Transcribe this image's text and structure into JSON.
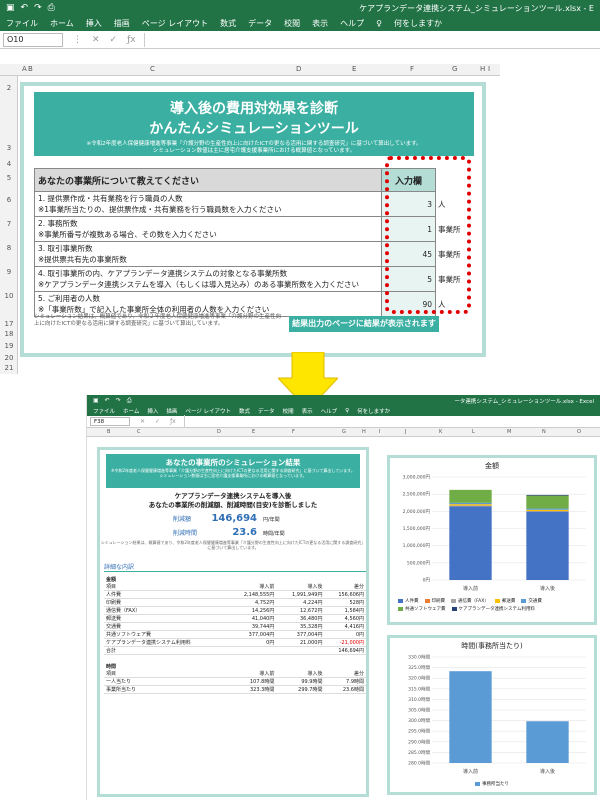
{
  "window": {
    "title": "ケアプランデータ連携システム_シミュレーションツール.xlsx  -  E"
  },
  "menu": [
    "ファイル",
    "ホーム",
    "挿入",
    "描画",
    "ページ レイアウト",
    "数式",
    "データ",
    "校閲",
    "表示",
    "ヘルプ"
  ],
  "search_hint": "何をしますか",
  "namebox": "O10",
  "columns": [
    "A",
    "B",
    "C",
    "D",
    "E",
    "F",
    "G",
    "H",
    "I"
  ],
  "rows": [
    "2",
    "3",
    "4",
    "5",
    "6",
    "7",
    "8",
    "9",
    "10",
    "17",
    "18",
    "19",
    "20",
    "21"
  ],
  "banner": {
    "title1": "導入後の費用対効果を診断",
    "title2": "かんたんシミュレーションツール",
    "note1": "※令和2年度老人保健健康増進等事業「介護分野の生産性向上に向けたICTの更なる活用に関する調査研究」に基づいて算出しています。",
    "note2": "シミュレーション数値は主に居宅介護支援事業所における概算値となっています。"
  },
  "form": {
    "header": "あなたの事業所について教えてください",
    "input_header": "入力欄",
    "questions": [
      {
        "line1": "1. 提供票作成・共有業務を行う職員の人数",
        "line2": "※1事業所当たりの、提供票作成・共有業務を行う職員数を入力ください",
        "value": "3",
        "unit": "人"
      },
      {
        "line1": "2. 事務所数",
        "line2": "※事業所番号が複数ある場合、その数を入力ください",
        "value": "1",
        "unit": "事業所"
      },
      {
        "line1": "3. 取引事業所数",
        "line2": "※提供票共有先の事業所数",
        "value": "45",
        "unit": "事業所"
      },
      {
        "line1": "4. 取引事業所の内、ケアプランデータ連携システムの対象となる事業所数",
        "line2": "※ケアプランデータ連携システムを導入（もしくは導入見込み）のある事業所数を入力ください",
        "value": "5",
        "unit": "事業所"
      },
      {
        "line1": "5. ご利用者の人数",
        "line2": "※「事業所数」で記入した事業所全体の利用者の人数を入力ください",
        "value": "90",
        "unit": "人"
      }
    ],
    "note": "シミュレーション結果は、概算値であり、令和２年度老人保健健康増進等事業「介護分野の生産性向上に向けたICTの更なる活用に関する調査研究」に基づいて算出しています。",
    "result_button": "結果出力のページに結果が表示されます"
  },
  "result_window": {
    "title": "ータ連携システム_シミュレーションツール.xlsx - Excel",
    "menu": [
      "ファイル",
      "ホーム",
      "挿入",
      "描画",
      "ページ レイアウト",
      "数式",
      "データ",
      "校閲",
      "表示",
      "ヘルプ"
    ],
    "search_hint": "何をしますか",
    "namebox": "F38",
    "columns": [
      "B",
      "C",
      "D",
      "E",
      "F",
      "G",
      "H",
      "I",
      "J",
      "K",
      "L",
      "M",
      "N",
      "O"
    ]
  },
  "result": {
    "title": "あなたの事業所のシミュレーション結果",
    "subtitle1": "※令和2年度老人保健健康増進等事業「介護分野の生産性向上に向けたICTの更なる活用に関する調査研究」に基づいて算出しています。",
    "subtitle2": "シミュレーション数値は主に居宅介護支援事業所における概算値となっています。",
    "heading1": "ケアプランデータ連携システムを導入後",
    "heading2": "あなたの事業所の削減額、削減時間(目安)を診断しました",
    "saving_amount_label": "削減額",
    "saving_amount": "146,694",
    "saving_amount_unit": "円/年間",
    "saving_time_label": "削減時間",
    "saving_time": "23.6",
    "saving_time_unit": "時間/年間",
    "disclaimer": "シミュレーション結果は、概算値であり、令和2年度老人保健健康増進等事業「介護分野の生産性向上に向けたICTの更なる活用に関する調査研究」に基づいて算出しています。",
    "detail_title": "詳細な内訳",
    "money_section": "金額",
    "headers": [
      "項目",
      "導入前",
      "導入後",
      "差分"
    ],
    "money_rows": [
      {
        "item": "人件費",
        "before": "2,148,555円",
        "after": "1,991,949円",
        "diff": "156,606円"
      },
      {
        "item": "印刷費",
        "before": "4,752円",
        "after": "4,224円",
        "diff": "528円"
      },
      {
        "item": "通信費（FAX）",
        "before": "14,256円",
        "after": "12,672円",
        "diff": "1,584円"
      },
      {
        "item": "郵送費",
        "before": "41,040円",
        "after": "36,480円",
        "diff": "4,560円"
      },
      {
        "item": "交通費",
        "before": "39,744円",
        "after": "35,328円",
        "diff": "4,416円"
      },
      {
        "item": "共通ソフトウェア費",
        "before": "377,004円",
        "after": "377,004円",
        "diff": "0円"
      },
      {
        "item": "ケアプランデータ連携システム利用料",
        "before": "0円",
        "after": "21,000円",
        "diff": "-21,000円"
      }
    ],
    "total_label": "合計",
    "total_value": "146,694円",
    "time_section": "時間",
    "time_rows": [
      {
        "item": "一人当たり",
        "before": "107.8時間",
        "after": "99.9時間",
        "diff": "7.9時間"
      },
      {
        "item": "事業所当たり",
        "before": "323.3時間",
        "after": "299.7時間",
        "diff": "23.6時間"
      }
    ]
  },
  "chart_data": [
    {
      "type": "bar",
      "stacked": true,
      "title": "金額",
      "categories": [
        "導入前",
        "導入後"
      ],
      "ylim": [
        0,
        3000000
      ],
      "yticks": [
        "3,000,000円",
        "2,500,000円",
        "2,000,000円",
        "1,500,000円",
        "1,000,000円",
        "500,000円",
        "0円"
      ],
      "series": [
        {
          "name": "人件費",
          "values": [
            2148555,
            1991949
          ],
          "color": "#4472c4"
        },
        {
          "name": "印刷費",
          "values": [
            4752,
            4224
          ],
          "color": "#ed7d31"
        },
        {
          "name": "通信費（FAX）",
          "values": [
            14256,
            12672
          ],
          "color": "#a5a5a5"
        },
        {
          "name": "郵送費",
          "values": [
            41040,
            36480
          ],
          "color": "#ffc000"
        },
        {
          "name": "交通費",
          "values": [
            39744,
            35328
          ],
          "color": "#5b9bd5"
        },
        {
          "name": "共通ソフトウェア費",
          "values": [
            377004,
            377004
          ],
          "color": "#70ad47"
        },
        {
          "name": "ケアプランデータ連携システム利用料",
          "values": [
            0,
            21000
          ],
          "color": "#264478"
        }
      ],
      "legend": "bottom"
    },
    {
      "type": "bar",
      "title": "時間(事務所当たり)",
      "categories": [
        "導入前",
        "導入後"
      ],
      "ylim": [
        280,
        330
      ],
      "yticks": [
        "330.0時間",
        "325.0時間",
        "320.0時間",
        "315.0時間",
        "310.0時間",
        "305.0時間",
        "300.0時間",
        "295.0時間",
        "290.0時間",
        "285.0時間",
        "280.0時間"
      ],
      "series": [
        {
          "name": "事務所当たり",
          "values": [
            323.3,
            299.7
          ],
          "color": "#5b9bd5"
        }
      ],
      "legend": "bottom"
    }
  ]
}
